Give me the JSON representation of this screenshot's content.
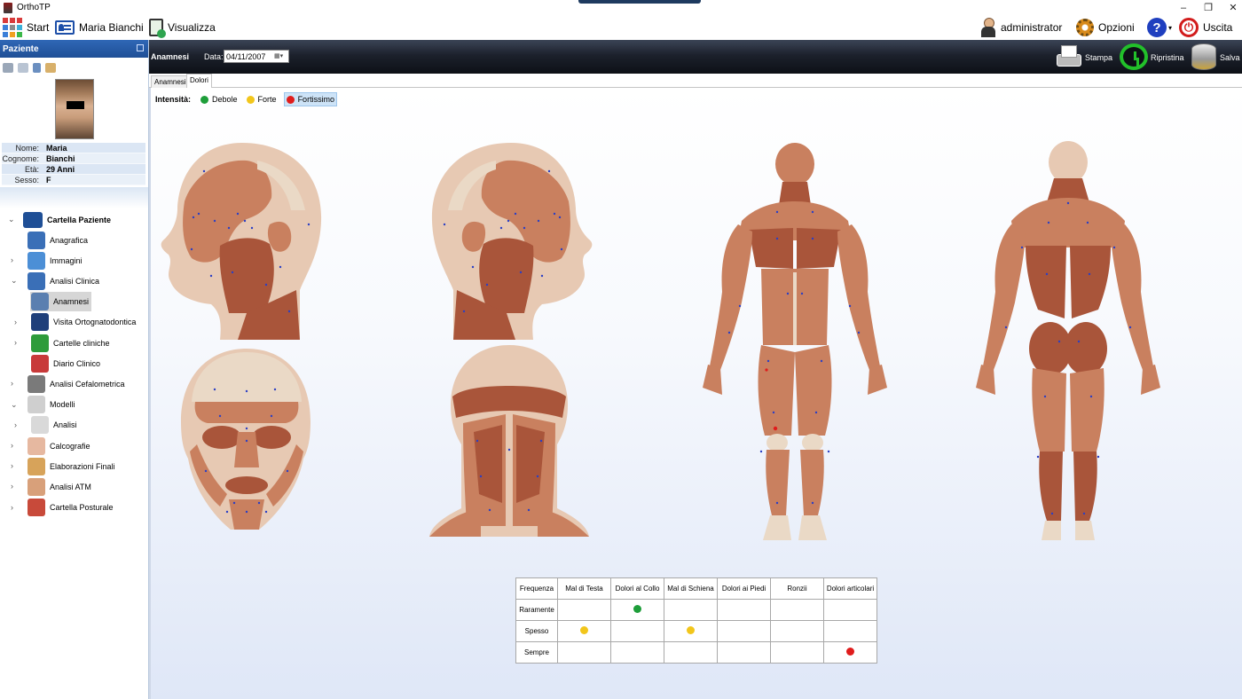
{
  "window": {
    "title": "OrthoTP",
    "controls": [
      "–",
      "❐",
      "✕"
    ]
  },
  "menubar": {
    "start": "Start",
    "patient": "Maria Bianchi",
    "view": "Visualizza",
    "user": "administrator",
    "options": "Opzioni",
    "help_arrow": "▾",
    "exit": "Uscita"
  },
  "left_panel": {
    "header": "Paziente",
    "info": [
      {
        "label": "Nome:",
        "value": "Maria"
      },
      {
        "label": "Cognome:",
        "value": "Bianchi"
      },
      {
        "label": "Età:",
        "value": "29 Anni"
      },
      {
        "label": "Sesso:",
        "value": "F"
      }
    ],
    "tree": {
      "root": "Cartella Paziente",
      "items": [
        {
          "label": "Anagrafica",
          "icon": "person-icon",
          "color": "#3a6fb7",
          "expander": ""
        },
        {
          "label": "Immagini",
          "icon": "images-icon",
          "color": "#4c8fd6",
          "expander": "›"
        },
        {
          "label": "Analisi Clinica",
          "icon": "stethoscope-icon",
          "color": "#3a6fb7",
          "expander": "⌄"
        },
        {
          "label": "Anamnesi",
          "icon": "clipboard-pen-icon",
          "color": "#5a7fb0",
          "expander": ""
        },
        {
          "label": "Visita Ortognatodontica",
          "icon": "doctor-icon",
          "color": "#1f3f7a",
          "expander": "›"
        },
        {
          "label": "Cartelle cliniche",
          "icon": "folder-green-icon",
          "color": "#2e9b3a",
          "expander": "›"
        },
        {
          "label": "Diario Clinico",
          "icon": "diary-icon",
          "color": "#c83a3a",
          "expander": ""
        },
        {
          "label": "Analisi Cefalometrica",
          "icon": "skull-xray-icon",
          "color": "#7a7a7a",
          "expander": "›"
        },
        {
          "label": "Modelli",
          "icon": "models-icon",
          "color": "#cfcfcf",
          "expander": "⌄"
        },
        {
          "label": "Analisi",
          "icon": "dental-arch-icon",
          "color": "#d9d9d9",
          "expander": "›"
        },
        {
          "label": "Calcografie",
          "icon": "tracing-icon",
          "color": "#e6b8a0",
          "expander": "›"
        },
        {
          "label": "Elaborazioni Finali",
          "icon": "head-profile-icon",
          "color": "#d7a35a",
          "expander": "›"
        },
        {
          "label": "Analisi ATM",
          "icon": "jaw-icon",
          "color": "#d8a07a",
          "expander": "›"
        },
        {
          "label": "Cartella Posturale",
          "icon": "posture-icon",
          "color": "#c84a3a",
          "expander": "›"
        }
      ]
    }
  },
  "toolbar": {
    "section": "Anamnesi",
    "date_label": "Data:",
    "date_value": "04/11/2007",
    "print": "Stampa",
    "restore": "Ripristina",
    "save": "Salva"
  },
  "tabs": [
    "Anamnesi",
    "Dolori"
  ],
  "intensity": {
    "label": "Intensità:",
    "levels": [
      {
        "name": "Debole",
        "color": "#1e9e3a"
      },
      {
        "name": "Forte",
        "color": "#f2c61b"
      },
      {
        "name": "Fortissimo",
        "color": "#e01c1c"
      }
    ]
  },
  "frequency_table": {
    "headers": [
      "Frequenza",
      "Mal di Testa",
      "Dolori al Collo",
      "Mal di Schiena",
      "Dolori ai Piedi",
      "Ronzii",
      "Dolori articolari"
    ],
    "rows": [
      {
        "label": "Raramente",
        "cells": [
          "",
          "green",
          "",
          "",
          "",
          ""
        ]
      },
      {
        "label": "Spesso",
        "cells": [
          "yellow",
          "",
          "yellow",
          "",
          "",
          ""
        ]
      },
      {
        "label": "Sempre",
        "cells": [
          "",
          "",
          "",
          "",
          "",
          "red"
        ]
      }
    ],
    "colors": {
      "green": "#1e9e3a",
      "yellow": "#f2c61b",
      "red": "#e01c1c"
    }
  }
}
